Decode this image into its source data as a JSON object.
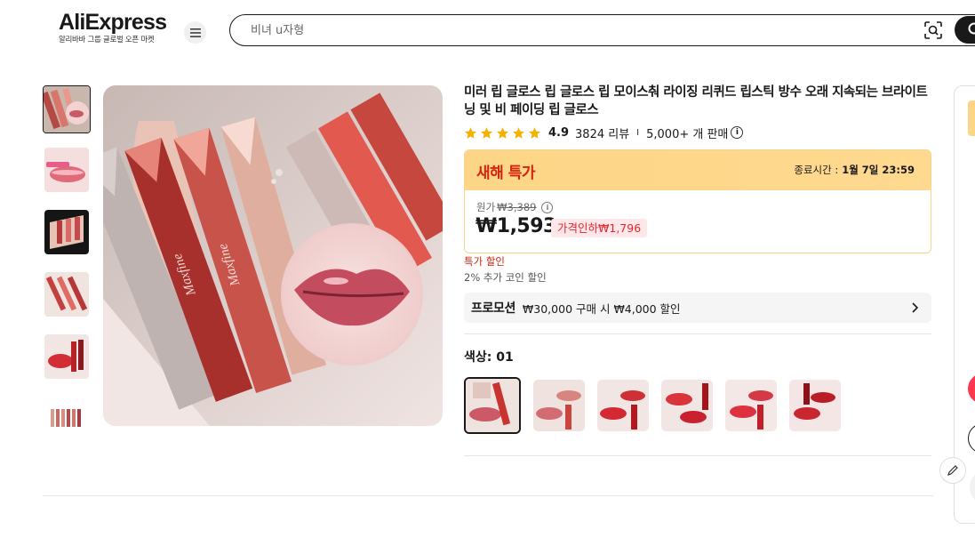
{
  "header": {
    "logo_text": "AliExpress",
    "logo_tagline": "알리바바 그룹 글로벌 오픈 마켓",
    "search_placeholder": "비녀 u자형",
    "menu_icon": "hamburger-menu-icon",
    "camera_icon": "image-search-icon"
  },
  "product": {
    "title": "미러 립 글로스 립 글로스 립 모이스춰 라이징 리퀴드 립스틱 방수 오래 지속되는 브라이트닝 및 비 페이딩 립 글로스",
    "rating": "4.9",
    "star_count": 5,
    "reviews": "3824 리뷰",
    "separator": "I",
    "sold": "5,000+ 개 판매",
    "info_glyph": "i"
  },
  "deal": {
    "title": "새해 특가",
    "end_label": "종료시간 :",
    "end_time": "1월 7일 23:59",
    "original_label": "원가",
    "original_price": "₩3,389",
    "price": "₩1,593",
    "discount": "가격인하₩1,796",
    "sale_tag": "특가 할인",
    "coin_tag": "2% 추가 코인 할인"
  },
  "promotion": {
    "label": "프로모션",
    "text": "₩30,000 구매 시 ₩4,000 할인"
  },
  "variants": {
    "label": "색상: 01",
    "count": 6,
    "selected_index": 0
  },
  "gallery": {
    "thumbnail_count": 6,
    "selected_index": 0
  },
  "colors": {
    "accent_red": "#d4240f",
    "deal_yellow": "#fdd587",
    "discount_bg": "#fde7e9",
    "star": "#f5b100"
  }
}
